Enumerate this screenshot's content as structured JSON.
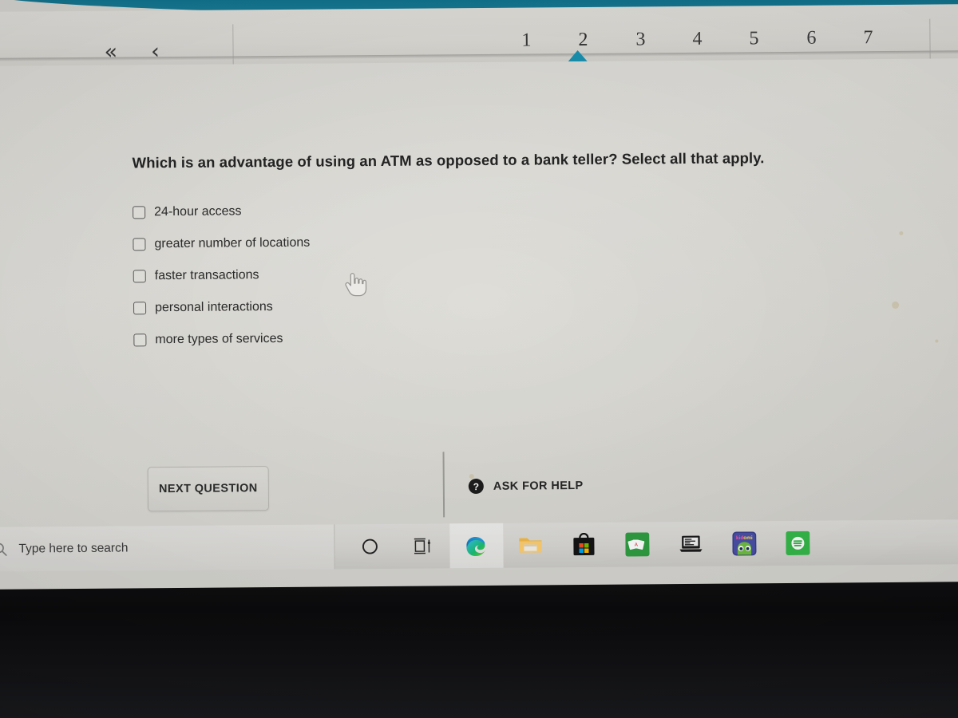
{
  "theme": {
    "banner_color": "#11758f",
    "marker_color": "#1993b3",
    "screen_bg": "#dedcd7",
    "text_color": "#2b2b2b"
  },
  "nav": {
    "back_all_icon": "chevron-double-left-icon",
    "back_all_glyph": "«",
    "back_icon": "chevron-left-icon",
    "back_glyph": "‹",
    "question_numbers": [
      "1",
      "2",
      "3",
      "4",
      "5",
      "6",
      "7"
    ],
    "active_question": "2",
    "active_marker_icon": "triangle-up-marker"
  },
  "quiz": {
    "question": "Which is an advantage of using an ATM as opposed to a bank teller? Select all that apply.",
    "options": [
      {
        "label": "24-hour access",
        "checked": false
      },
      {
        "label": "greater number of locations",
        "checked": false
      },
      {
        "label": "faster transactions",
        "checked": false
      },
      {
        "label": "personal interactions",
        "checked": false
      },
      {
        "label": "more types of services",
        "checked": false
      }
    ]
  },
  "actions": {
    "next_label": "NEXT QUESTION",
    "help_label": "ASK FOR HELP",
    "help_icon": "question-mark-circle-icon",
    "help_glyph": "?"
  },
  "cursor": {
    "type": "pointing-hand-cursor"
  },
  "taskbar": {
    "search_placeholder": "Type here to search",
    "search_icon": "search-magnifier-icon",
    "items": [
      {
        "name": "cortana-icon",
        "label": "Cortana",
        "running": false
      },
      {
        "name": "task-view-icon",
        "label": "Task View",
        "running": false
      },
      {
        "name": "microsoft-edge-icon",
        "label": "Microsoft Edge",
        "running": true
      },
      {
        "name": "file-explorer-icon",
        "label": "File Explorer",
        "running": false
      },
      {
        "name": "microsoft-store-icon",
        "label": "Microsoft Store",
        "running": false
      },
      {
        "name": "solitaire-icon",
        "label": "Solitaire",
        "running": false
      },
      {
        "name": "remote-laptop-icon",
        "label": "Laptop App",
        "running": false
      },
      {
        "name": "kidomi-icon",
        "label": "Kidomi",
        "running": false
      },
      {
        "name": "green-media-icon",
        "label": "Media App",
        "running": false
      }
    ]
  }
}
